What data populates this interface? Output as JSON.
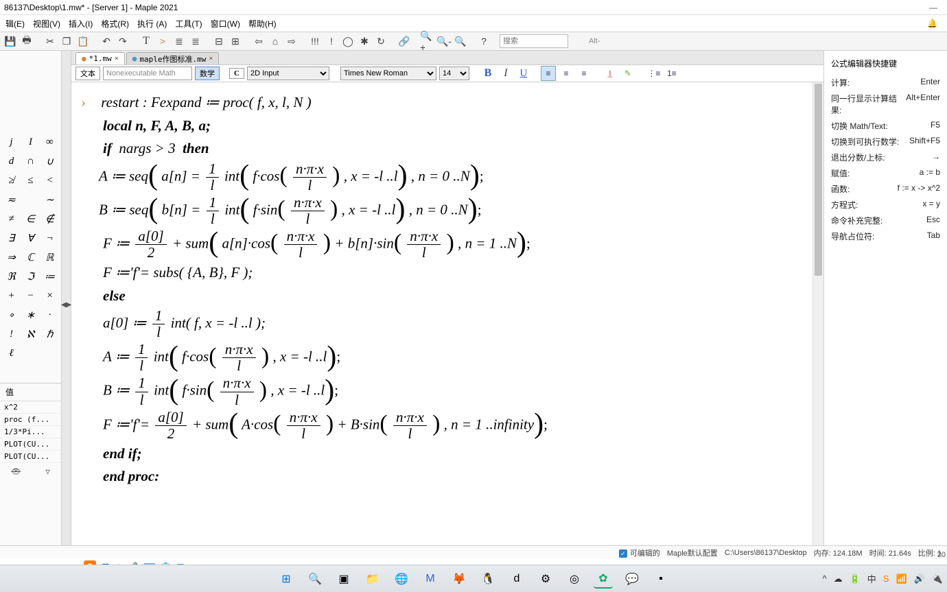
{
  "window": {
    "title": "86137\\Desktop\\1.mw* - [Server 1] - Maple 2021",
    "minimize": "—",
    "bell": "🔔"
  },
  "menu": {
    "items": [
      "辑(E)",
      "视图(V)",
      "插入(I)",
      "格式(R)",
      "执行 (A)",
      "工具(T)",
      "窗口(W)",
      "帮助(H)"
    ],
    "bell": "🔔"
  },
  "toolbar1": {
    "search_placeholder": "搜索",
    "alt_hint": "Alt-"
  },
  "tabs": {
    "items": [
      {
        "label": "*1.mw",
        "active": true
      },
      {
        "label": "maple作图标准.mw",
        "active": false
      }
    ],
    "close_x": "×"
  },
  "formatbar": {
    "btn_text": "文本",
    "btn_nonexec": "Nonexecutable Math",
    "btn_math": "数学",
    "cfg_icon": "C",
    "mode": "2D Input",
    "font": "Times New Roman",
    "size": "14"
  },
  "palette": {
    "grid": [
      "j",
      "I",
      "∞",
      "d",
      "∩",
      "∪",
      "≱",
      "≤",
      "<",
      "≂",
      " ",
      "∼",
      "≠",
      "∈",
      "∉",
      "∃",
      "∀",
      "¬",
      "⇒",
      "ℂ",
      "ℝ",
      "ℜ",
      "ℑ",
      "≔",
      "+",
      "−",
      "×",
      "∘",
      "∗",
      "·",
      "!",
      "ℵ",
      "ℏ",
      "ℓ",
      " ",
      " "
    ],
    "values_hdr": "值",
    "values": [
      "x^2",
      "proc (f...",
      "1/3*Pi...",
      "PLOT(CU...",
      "PLOT(CU..."
    ],
    "eye": "👁",
    "funnel": "▽"
  },
  "worksheet": {
    "l1": "restart : Fexpand ≔ proc( f, x, l, N )",
    "l2": "local  n, F, A, B, a;",
    "l3": "if  nargs > 3  then",
    "l4_A": "A ≔ seq",
    "l4_Bpart": "a[n] =",
    "l4_int": "int",
    "l4_fcos": "f·cos",
    "npi": "n·π·x",
    "ell": "l",
    "one": "1",
    "rng_l": ", x = -l ..l",
    "rng_n0": ", n = 0 ..N",
    "l5_B": "B ≔ seq",
    "l5_bn": "b[n] =",
    "l5_fsin": "f·sin",
    "l6_F": "F ≔ ",
    "a0": "a[0]",
    "two": "2",
    "plus_sum": " + sum",
    "ancos": "a[n]·cos",
    "bnsin": " + b[n]·sin",
    "rng_n1": ", n = 1 ..N",
    "l7": "F ≔'f'= subs( {A, B}, F );",
    "l8": "else",
    "l9": "a[0] ≔ ",
    "l9_int": "int( f, x = -l ..l );",
    "l10_A": "A ≔ ",
    "l11_B": "B ≔ ",
    "l12_F": "F ≔'f'= ",
    "Acos": "A·cos",
    "Bsin": " + B·sin",
    "rng_inf": ", n = 1 ..infinity",
    "l13": "end if;",
    "l14": "end proc:"
  },
  "rightpanel": {
    "title": "公式编辑器快捷键",
    "rows": [
      {
        "lbl": "计算:",
        "val": "Enter"
      },
      {
        "lbl": "同一行显示计算结果:",
        "val": "Alt+Enter"
      },
      {
        "lbl": "切换 Math/Text:",
        "val": "F5"
      },
      {
        "lbl": "切换到可执行数学:",
        "val": "Shift+F5"
      },
      {
        "lbl": "退出分数/上标:",
        "val": "→"
      },
      {
        "lbl": "赋值:",
        "val": "a := b"
      },
      {
        "lbl": "函数:",
        "val": "f := x -> x^2"
      },
      {
        "lbl": "方程式:",
        "val": "x = y"
      },
      {
        "lbl": "命令补充完整:",
        "val": "Esc"
      },
      {
        "lbl": "导航占位符:",
        "val": "Tab"
      }
    ]
  },
  "statusbar": {
    "editable": "可编辑的",
    "profile": "Maple默认配置",
    "path": "C:\\Users\\86137\\Desktop",
    "mem_lbl": "内存:",
    "mem_val": "124.18M",
    "time_lbl": "时间:",
    "time_val": "21.64s",
    "ratio_lbl": "比例:",
    "ratio_val": "1",
    "corner": "20"
  },
  "sougou": {
    "ch": "英",
    "items": [
      "✦",
      "🎤",
      "⌨",
      "👕",
      "▦"
    ]
  }
}
